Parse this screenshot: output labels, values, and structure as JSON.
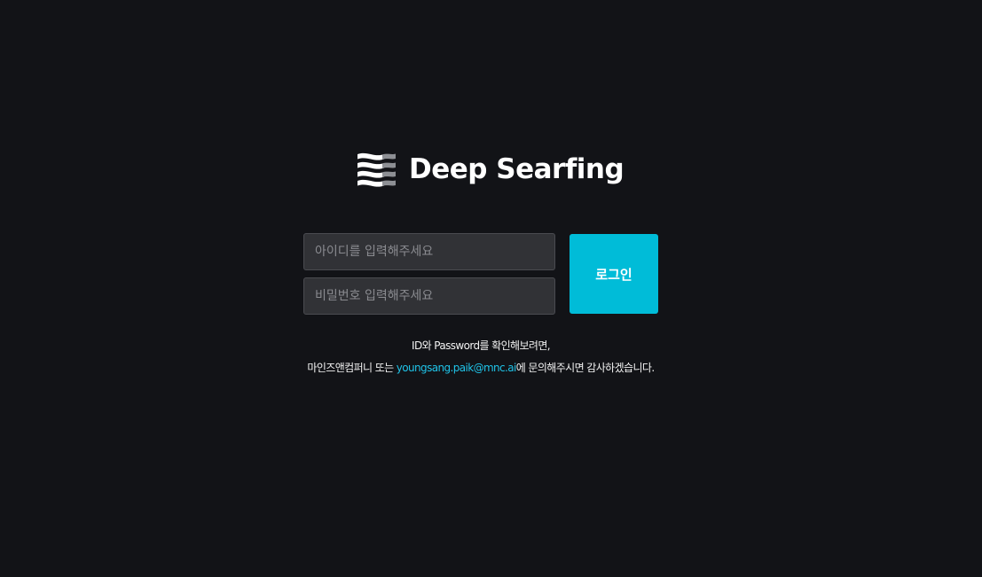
{
  "brand": {
    "name": "Deep Searfing",
    "icon": "layered-waves-logo-icon"
  },
  "login_form": {
    "id_placeholder": "아이디를 입력해주세요",
    "password_placeholder": "비밀번호 입력해주세요",
    "submit_label": "로그인"
  },
  "help": {
    "line1": "ID와 Password를 확인해보려면,",
    "line2_prefix": "마인즈앤컴퍼니 또는 ",
    "contact_email": "youngsang.paik@mnc.ai",
    "line2_suffix": "에 문의해주시면 감사하겠습니다."
  },
  "colors": {
    "background": "#121317",
    "accent": "#00bcd8",
    "link": "#1fc3e8",
    "input_background": "#313236"
  }
}
